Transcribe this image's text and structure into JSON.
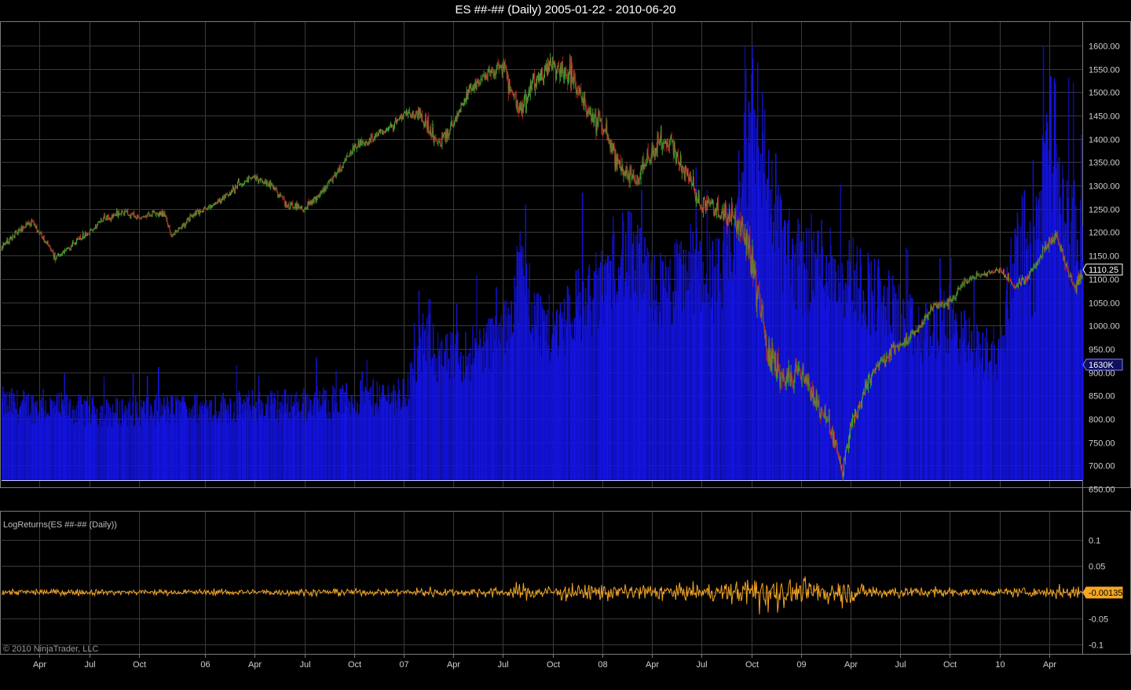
{
  "title": "ES ##-## (Daily)  2005-01-22 - 2010-06-20",
  "copyright": "© 2010 NinjaTrader, LLC",
  "colors": {
    "background": "#000000",
    "grid": "#3a3a3a",
    "volume": "#1414e6",
    "up_candle": "#2ea02e",
    "down_candle": "#b22222",
    "price_line": "#8a8a3a",
    "log_returns": "#f5a623",
    "panel_border": "#7a7a7a"
  },
  "chart_data": [
    {
      "type": "line",
      "name": "price_panel",
      "ylim": [
        650,
        1600
      ],
      "yticks": [
        1600,
        1550,
        1500,
        1450,
        1400,
        1350,
        1300,
        1250,
        1200,
        1150,
        1100,
        1050,
        1000,
        950,
        900,
        850,
        800,
        750,
        700,
        650
      ],
      "ytick_labels": [
        "1600.00",
        "1550.00",
        "1500.00",
        "1450.00",
        "1400.00",
        "1350.00",
        "1300.00",
        "1250.00",
        "1200.00",
        "1150.00",
        "1100.00",
        "1050.00",
        "1000.00",
        "950.00",
        "900.00",
        "850.00",
        "800.00",
        "750.00",
        "700.00",
        "650.00"
      ],
      "x_labels": [
        "Apr",
        "Jul",
        "Oct",
        "06",
        "Apr",
        "Jul",
        "Oct",
        "07",
        "Apr",
        "Jul",
        "Oct",
        "08",
        "Apr",
        "Jul",
        "Oct",
        "09",
        "Apr",
        "Jul",
        "Oct",
        "10",
        "Apr"
      ],
      "x_label_months": [
        2,
        5,
        8,
        12,
        15,
        18,
        21,
        24,
        27,
        30,
        33,
        36,
        39,
        42,
        45,
        48,
        51,
        54,
        57,
        60,
        63
      ],
      "x_start_month": -0.3,
      "x_end_month": 65.0,
      "price_keypoints": [
        [
          -0.3,
          1170
        ],
        [
          1.5,
          1225
        ],
        [
          3,
          1145
        ],
        [
          5,
          1200
        ],
        [
          6,
          1230
        ],
        [
          7,
          1245
        ],
        [
          8,
          1230
        ],
        [
          9.5,
          1245
        ],
        [
          10,
          1190
        ],
        [
          11,
          1230
        ],
        [
          12,
          1250
        ],
        [
          13,
          1270
        ],
        [
          14,
          1300
        ],
        [
          15,
          1320
        ],
        [
          16,
          1300
        ],
        [
          17,
          1260
        ],
        [
          18,
          1250
        ],
        [
          19,
          1285
        ],
        [
          20,
          1330
        ],
        [
          21,
          1380
        ],
        [
          22,
          1400
        ],
        [
          23,
          1420
        ],
        [
          24,
          1450
        ],
        [
          25,
          1455
        ],
        [
          26,
          1390
        ],
        [
          27,
          1430
        ],
        [
          28,
          1510
        ],
        [
          29,
          1540
        ],
        [
          30,
          1555
        ],
        [
          31,
          1460
        ],
        [
          32,
          1530
        ],
        [
          33,
          1560
        ],
        [
          34,
          1545
        ],
        [
          35,
          1470
        ],
        [
          36,
          1430
        ],
        [
          37,
          1340
        ],
        [
          38,
          1310
        ],
        [
          39,
          1380
        ],
        [
          40,
          1400
        ],
        [
          41,
          1330
        ],
        [
          42,
          1260
        ],
        [
          43,
          1250
        ],
        [
          44,
          1230
        ],
        [
          45,
          1150
        ],
        [
          46,
          950
        ],
        [
          47,
          880
        ],
        [
          48,
          900
        ],
        [
          48.5,
          870
        ],
        [
          49,
          830
        ],
        [
          50,
          760
        ],
        [
          50.5,
          690
        ],
        [
          51,
          780
        ],
        [
          52,
          880
        ],
        [
          53,
          930
        ],
        [
          54,
          960
        ],
        [
          55,
          990
        ],
        [
          56,
          1040
        ],
        [
          57,
          1050
        ],
        [
          58,
          1100
        ],
        [
          59,
          1110
        ],
        [
          60,
          1120
        ],
        [
          61,
          1080
        ],
        [
          62,
          1120
        ],
        [
          63,
          1180
        ],
        [
          63.5,
          1190
        ],
        [
          64,
          1130
        ],
        [
          64.5,
          1080
        ],
        [
          65,
          1110
        ]
      ],
      "last_price_label": "1110.25",
      "last_price": 1110.25
    },
    {
      "type": "bar",
      "name": "volume",
      "volume_label": "1630K",
      "volume_keypoints": [
        [
          -0.3,
          0.18
        ],
        [
          6,
          0.16
        ],
        [
          12,
          0.17
        ],
        [
          18,
          0.18
        ],
        [
          24,
          0.2
        ],
        [
          25.5,
          0.36
        ],
        [
          26,
          0.28
        ],
        [
          28,
          0.3
        ],
        [
          30,
          0.34
        ],
        [
          31,
          0.5
        ],
        [
          32,
          0.38
        ],
        [
          33,
          0.35
        ],
        [
          34,
          0.4
        ],
        [
          36,
          0.45
        ],
        [
          37,
          0.55
        ],
        [
          38,
          0.5
        ],
        [
          39,
          0.45
        ],
        [
          40,
          0.44
        ],
        [
          41,
          0.5
        ],
        [
          42,
          0.5
        ],
        [
          43,
          0.47
        ],
        [
          44,
          0.58
        ],
        [
          45,
          0.92
        ],
        [
          46,
          0.7
        ],
        [
          47,
          0.55
        ],
        [
          48,
          0.5
        ],
        [
          49,
          0.52
        ],
        [
          50,
          0.5
        ],
        [
          51,
          0.48
        ],
        [
          52,
          0.45
        ],
        [
          53,
          0.42
        ],
        [
          54,
          0.38
        ],
        [
          55,
          0.34
        ],
        [
          56,
          0.36
        ],
        [
          57,
          0.38
        ],
        [
          58,
          0.32
        ],
        [
          59,
          0.3
        ],
        [
          60,
          0.3
        ],
        [
          61,
          0.58
        ],
        [
          62,
          0.48
        ],
        [
          63,
          0.86
        ],
        [
          64,
          0.6
        ],
        [
          65,
          0.55
        ]
      ]
    },
    {
      "type": "line",
      "name": "LogReturns",
      "panel_label": "LogReturns(ES ##-## (Daily))",
      "ylim": [
        -0.1,
        0.1
      ],
      "yticks": [
        0.1,
        0.05,
        0.0,
        -0.05,
        -0.1
      ],
      "ytick_labels": [
        "0.1",
        "0.05",
        "0",
        "-0.05",
        "-0.1"
      ],
      "last_value_label": "-0.00135",
      "last_value": -0.00135,
      "volatility_keypoints": [
        [
          -0.3,
          0.008
        ],
        [
          12,
          0.007
        ],
        [
          18,
          0.009
        ],
        [
          24,
          0.008
        ],
        [
          25.5,
          0.015
        ],
        [
          27,
          0.01
        ],
        [
          30,
          0.013
        ],
        [
          31,
          0.02
        ],
        [
          33,
          0.018
        ],
        [
          36,
          0.02
        ],
        [
          38,
          0.02
        ],
        [
          40,
          0.02
        ],
        [
          43,
          0.02
        ],
        [
          44,
          0.025
        ],
        [
          45,
          0.05
        ],
        [
          46,
          0.045
        ],
        [
          47,
          0.035
        ],
        [
          48,
          0.03
        ],
        [
          50,
          0.032
        ],
        [
          52,
          0.02
        ],
        [
          54,
          0.015
        ],
        [
          56,
          0.013
        ],
        [
          58,
          0.01
        ],
        [
          60,
          0.008
        ],
        [
          61,
          0.012
        ],
        [
          62,
          0.01
        ],
        [
          63.5,
          0.015
        ],
        [
          64.5,
          0.02
        ],
        [
          65,
          0.012
        ]
      ]
    }
  ]
}
